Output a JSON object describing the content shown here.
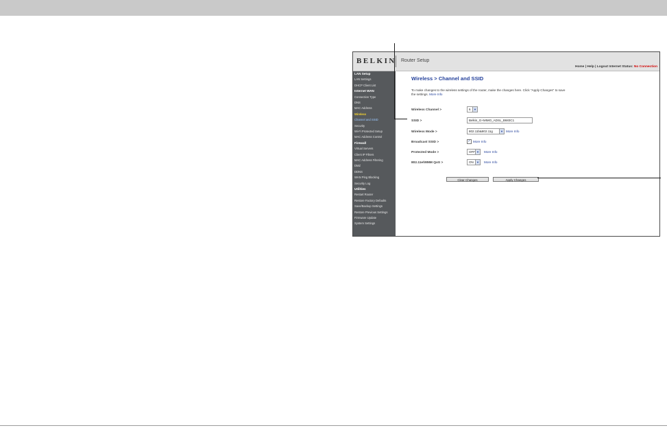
{
  "router": {
    "logo": "BELKIN",
    "subtitle": "Router Setup",
    "links": "Home | Help | Logout",
    "status_label": "Internet Status:",
    "status_value": "No Connection"
  },
  "sidebar": {
    "items": [
      {
        "label": "LAN Setup",
        "kind": "head"
      },
      {
        "label": "LAN Settings",
        "kind": "link"
      },
      {
        "label": "DHCP Client List",
        "kind": "link"
      },
      {
        "label": "Internet WAN",
        "kind": "head"
      },
      {
        "label": "Connection Type",
        "kind": "link"
      },
      {
        "label": "DNS",
        "kind": "link"
      },
      {
        "label": "MAC Address",
        "kind": "link"
      },
      {
        "label": "Wireless",
        "kind": "active"
      },
      {
        "label": "Channel and SSID",
        "kind": "current"
      },
      {
        "label": "Security",
        "kind": "link"
      },
      {
        "label": "Wi-Fi Protected Setup",
        "kind": "link"
      },
      {
        "label": "MAC Address Control",
        "kind": "link"
      },
      {
        "label": "Firewall",
        "kind": "head"
      },
      {
        "label": "Virtual Servers",
        "kind": "link"
      },
      {
        "label": "Client IP Filters",
        "kind": "link"
      },
      {
        "label": "MAC Address Filtering",
        "kind": "link"
      },
      {
        "label": "DMZ",
        "kind": "link"
      },
      {
        "label": "DDNS",
        "kind": "link"
      },
      {
        "label": "WAN Ping Blocking",
        "kind": "link"
      },
      {
        "label": "Security Log",
        "kind": "link"
      },
      {
        "label": "Utilities",
        "kind": "head"
      },
      {
        "label": "Restart Router",
        "kind": "link"
      },
      {
        "label": "Restore Factory Defaults",
        "kind": "link"
      },
      {
        "label": "Save/Backup Settings",
        "kind": "link"
      },
      {
        "label": "Restore Previous Settings",
        "kind": "link"
      },
      {
        "label": "Firmware Update",
        "kind": "link"
      },
      {
        "label": "System Settings",
        "kind": "link"
      }
    ]
  },
  "main": {
    "title": "Wireless > Channel and SSID",
    "intro": "To make changes to the wireless settings of the router, make the changes here. Click \"Apply Changes\" to save the settings.",
    "intro_link": "More Info",
    "fields": {
      "channel": {
        "label": "Wireless Channel >",
        "value": "6"
      },
      "ssid": {
        "label": "SSID >",
        "value": "Belkin_G+MIMO_ADSL_B683C1"
      },
      "mode": {
        "label": "Wireless Mode >",
        "value": "802.11b&802.11g",
        "more": "More Info"
      },
      "broadcast": {
        "label": "Broadcast SSID >",
        "checked": true,
        "more": "More Info"
      },
      "protected": {
        "label": "Protected Mode >",
        "value": "OFF",
        "more": "More Info"
      },
      "qos": {
        "label": "802.11e/WMM QoS >",
        "value": "ON",
        "more": "More Info"
      }
    },
    "buttons": {
      "clear": "Clear Changes",
      "apply": "Apply Changes"
    }
  },
  "colors": {
    "accent": "#24419b",
    "sidebar_bg": "#56595c",
    "status_alert": "#d10000",
    "active_section": "#f4d330"
  }
}
